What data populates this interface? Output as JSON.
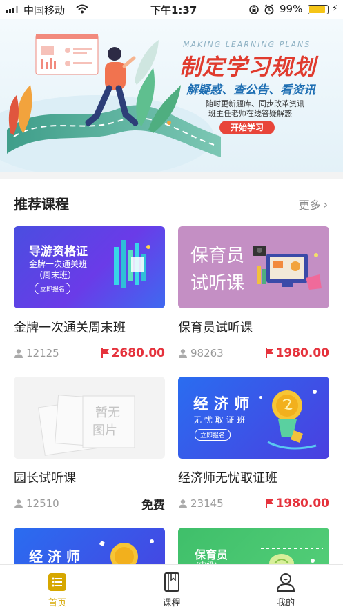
{
  "status_bar": {
    "carrier": "中国移动",
    "time": "下午1:37",
    "battery_pct": "99%",
    "battery_level": 0.99
  },
  "banner": {
    "eyebrow": "MAKING LEARNING PLANS",
    "title": "制定学习规划",
    "subtitle": "解疑惑、查公告、看资讯",
    "desc_line1": "随时更新题库、同步改革资讯",
    "desc_line2": "班主任老师在线答疑解惑",
    "cta": "开始学习"
  },
  "section": {
    "title": "推荐课程",
    "more": "更多"
  },
  "courses": [
    {
      "name": "金牌一次通关周末班",
      "views": "12125",
      "price": "2680.00",
      "thumb": {
        "line1": "导游资格证",
        "line2": "金牌一次通关班",
        "line3": "（周末班）",
        "btn": "立即报名"
      }
    },
    {
      "name": "保育员试听课",
      "views": "98263",
      "price": "1980.00",
      "thumb": {
        "line1": "保育员",
        "line2": "试听课"
      }
    },
    {
      "name": "园长试听课",
      "views": "12510",
      "price": "免费",
      "thumb": {
        "line1": "暂无",
        "line2": "图片"
      }
    },
    {
      "name": "经济师无忧取证班",
      "views": "23145",
      "price": "1980.00",
      "thumb": {
        "line1": "经 济 师",
        "line2": "无 忧 取 证 班",
        "btn": "立即报名"
      }
    },
    {
      "thumb": {
        "line1": "经 济 师"
      }
    },
    {
      "thumb": {
        "line1": "保育员",
        "line2": "(中级)"
      }
    }
  ],
  "tabbar": [
    {
      "label": "首页",
      "active": true,
      "icon": "home-list-icon"
    },
    {
      "label": "课程",
      "active": false,
      "icon": "book-icon"
    },
    {
      "label": "我的",
      "active": false,
      "icon": "profile-icon"
    }
  ],
  "colors": {
    "accent": "#d6a700",
    "price_red": "#e5323c",
    "banner_red": "#e03b2e"
  }
}
